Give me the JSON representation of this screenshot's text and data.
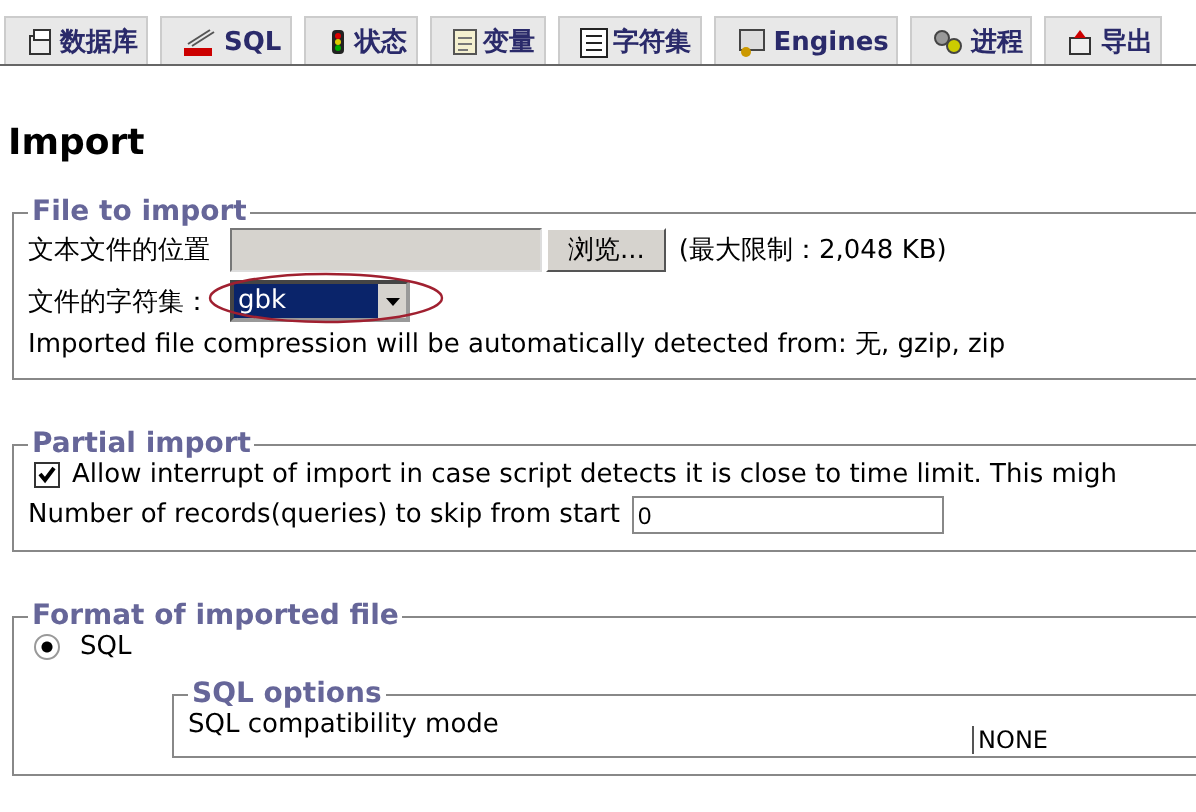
{
  "tabs": [
    {
      "label": "数据库",
      "selected": false
    },
    {
      "label": "SQL",
      "selected": false
    },
    {
      "label": "状态",
      "selected": false
    },
    {
      "label": "变量",
      "selected": false
    },
    {
      "label": "字符集",
      "selected": false
    },
    {
      "label": "Engines",
      "selected": false
    },
    {
      "label": "进程",
      "selected": false
    },
    {
      "label": "导出",
      "selected": false
    }
  ],
  "heading": "Import",
  "file_to_import": {
    "legend": "File to import",
    "location_label": "文本文件的位置",
    "browse_button": "浏览...",
    "max_size": "(最大限制：2,048 KB)",
    "charset_label": "文件的字符集：",
    "charset_value": "gbk",
    "charset_highlighted": true,
    "compression_note": "Imported file compression will be automatically detected from: 无, gzip, zip"
  },
  "partial_import": {
    "legend": "Partial import",
    "allow_interrupt": {
      "label": "Allow interrupt of import in case script detects it is close to time limit. This migh",
      "checked": true
    },
    "skip_label": "Number of records(queries) to skip from start",
    "skip_value": "0"
  },
  "format": {
    "legend": "Format of imported file",
    "options": [
      {
        "label": "SQL",
        "selected": true
      }
    ],
    "sql_options": {
      "legend": "SQL options",
      "compat_label": "SQL compatibility mode",
      "compat_value": "NONE"
    }
  }
}
